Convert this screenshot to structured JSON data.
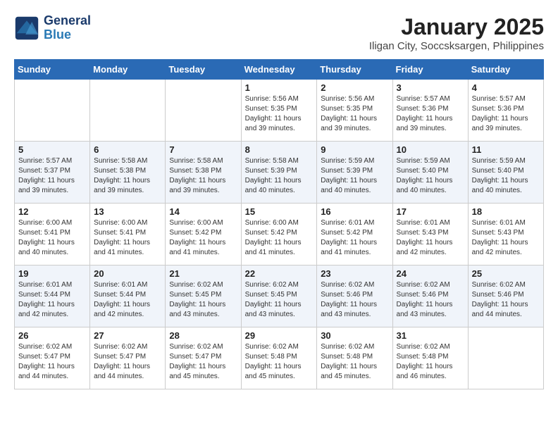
{
  "header": {
    "logo_line1": "General",
    "logo_line2": "Blue",
    "month": "January 2025",
    "city": "Iligan City, Soccsksargen, Philippines"
  },
  "days_of_week": [
    "Sunday",
    "Monday",
    "Tuesday",
    "Wednesday",
    "Thursday",
    "Friday",
    "Saturday"
  ],
  "weeks": [
    [
      {
        "day": "",
        "info": ""
      },
      {
        "day": "",
        "info": ""
      },
      {
        "day": "",
        "info": ""
      },
      {
        "day": "1",
        "info": "Sunrise: 5:56 AM\nSunset: 5:35 PM\nDaylight: 11 hours\nand 39 minutes."
      },
      {
        "day": "2",
        "info": "Sunrise: 5:56 AM\nSunset: 5:35 PM\nDaylight: 11 hours\nand 39 minutes."
      },
      {
        "day": "3",
        "info": "Sunrise: 5:57 AM\nSunset: 5:36 PM\nDaylight: 11 hours\nand 39 minutes."
      },
      {
        "day": "4",
        "info": "Sunrise: 5:57 AM\nSunset: 5:36 PM\nDaylight: 11 hours\nand 39 minutes."
      }
    ],
    [
      {
        "day": "5",
        "info": "Sunrise: 5:57 AM\nSunset: 5:37 PM\nDaylight: 11 hours\nand 39 minutes."
      },
      {
        "day": "6",
        "info": "Sunrise: 5:58 AM\nSunset: 5:38 PM\nDaylight: 11 hours\nand 39 minutes."
      },
      {
        "day": "7",
        "info": "Sunrise: 5:58 AM\nSunset: 5:38 PM\nDaylight: 11 hours\nand 39 minutes."
      },
      {
        "day": "8",
        "info": "Sunrise: 5:58 AM\nSunset: 5:39 PM\nDaylight: 11 hours\nand 40 minutes."
      },
      {
        "day": "9",
        "info": "Sunrise: 5:59 AM\nSunset: 5:39 PM\nDaylight: 11 hours\nand 40 minutes."
      },
      {
        "day": "10",
        "info": "Sunrise: 5:59 AM\nSunset: 5:40 PM\nDaylight: 11 hours\nand 40 minutes."
      },
      {
        "day": "11",
        "info": "Sunrise: 5:59 AM\nSunset: 5:40 PM\nDaylight: 11 hours\nand 40 minutes."
      }
    ],
    [
      {
        "day": "12",
        "info": "Sunrise: 6:00 AM\nSunset: 5:41 PM\nDaylight: 11 hours\nand 40 minutes."
      },
      {
        "day": "13",
        "info": "Sunrise: 6:00 AM\nSunset: 5:41 PM\nDaylight: 11 hours\nand 41 minutes."
      },
      {
        "day": "14",
        "info": "Sunrise: 6:00 AM\nSunset: 5:42 PM\nDaylight: 11 hours\nand 41 minutes."
      },
      {
        "day": "15",
        "info": "Sunrise: 6:00 AM\nSunset: 5:42 PM\nDaylight: 11 hours\nand 41 minutes."
      },
      {
        "day": "16",
        "info": "Sunrise: 6:01 AM\nSunset: 5:42 PM\nDaylight: 11 hours\nand 41 minutes."
      },
      {
        "day": "17",
        "info": "Sunrise: 6:01 AM\nSunset: 5:43 PM\nDaylight: 11 hours\nand 42 minutes."
      },
      {
        "day": "18",
        "info": "Sunrise: 6:01 AM\nSunset: 5:43 PM\nDaylight: 11 hours\nand 42 minutes."
      }
    ],
    [
      {
        "day": "19",
        "info": "Sunrise: 6:01 AM\nSunset: 5:44 PM\nDaylight: 11 hours\nand 42 minutes."
      },
      {
        "day": "20",
        "info": "Sunrise: 6:01 AM\nSunset: 5:44 PM\nDaylight: 11 hours\nand 42 minutes."
      },
      {
        "day": "21",
        "info": "Sunrise: 6:02 AM\nSunset: 5:45 PM\nDaylight: 11 hours\nand 43 minutes."
      },
      {
        "day": "22",
        "info": "Sunrise: 6:02 AM\nSunset: 5:45 PM\nDaylight: 11 hours\nand 43 minutes."
      },
      {
        "day": "23",
        "info": "Sunrise: 6:02 AM\nSunset: 5:46 PM\nDaylight: 11 hours\nand 43 minutes."
      },
      {
        "day": "24",
        "info": "Sunrise: 6:02 AM\nSunset: 5:46 PM\nDaylight: 11 hours\nand 43 minutes."
      },
      {
        "day": "25",
        "info": "Sunrise: 6:02 AM\nSunset: 5:46 PM\nDaylight: 11 hours\nand 44 minutes."
      }
    ],
    [
      {
        "day": "26",
        "info": "Sunrise: 6:02 AM\nSunset: 5:47 PM\nDaylight: 11 hours\nand 44 minutes."
      },
      {
        "day": "27",
        "info": "Sunrise: 6:02 AM\nSunset: 5:47 PM\nDaylight: 11 hours\nand 44 minutes."
      },
      {
        "day": "28",
        "info": "Sunrise: 6:02 AM\nSunset: 5:47 PM\nDaylight: 11 hours\nand 45 minutes."
      },
      {
        "day": "29",
        "info": "Sunrise: 6:02 AM\nSunset: 5:48 PM\nDaylight: 11 hours\nand 45 minutes."
      },
      {
        "day": "30",
        "info": "Sunrise: 6:02 AM\nSunset: 5:48 PM\nDaylight: 11 hours\nand 45 minutes."
      },
      {
        "day": "31",
        "info": "Sunrise: 6:02 AM\nSunset: 5:48 PM\nDaylight: 11 hours\nand 46 minutes."
      },
      {
        "day": "",
        "info": ""
      }
    ]
  ]
}
